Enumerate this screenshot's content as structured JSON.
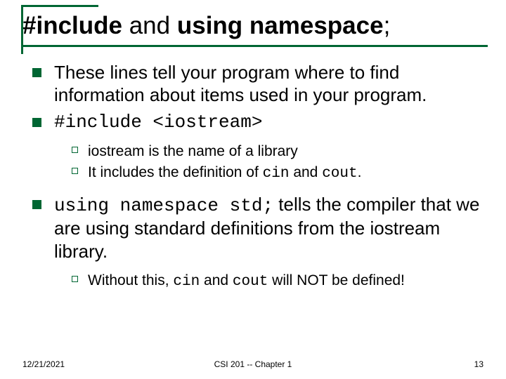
{
  "title": {
    "part1": "#include",
    "part2": " and ",
    "part3": "using namespace",
    "part4": ";"
  },
  "bullets": {
    "b1": "These lines tell your program where to find information about items used in your program.",
    "b2": "#include <iostream>",
    "b2_sub1": "iostream is the name of a library",
    "b2_sub2_a": "It includes the definition of ",
    "b2_sub2_b": "cin",
    "b2_sub2_c": " and ",
    "b2_sub2_d": "cout",
    "b2_sub2_e": ".",
    "b3_a": "using namespace std;",
    "b3_b": " tells the compiler that we are using standard definitions from the iostream library.",
    "b3_sub1_a": "Without this, ",
    "b3_sub1_b": "cin",
    "b3_sub1_c": " and ",
    "b3_sub1_d": "cout",
    "b3_sub1_e": " will NOT be defined!"
  },
  "footer": {
    "date": "12/21/2021",
    "center": "CSI 201 -- Chapter 1",
    "page": "13"
  }
}
